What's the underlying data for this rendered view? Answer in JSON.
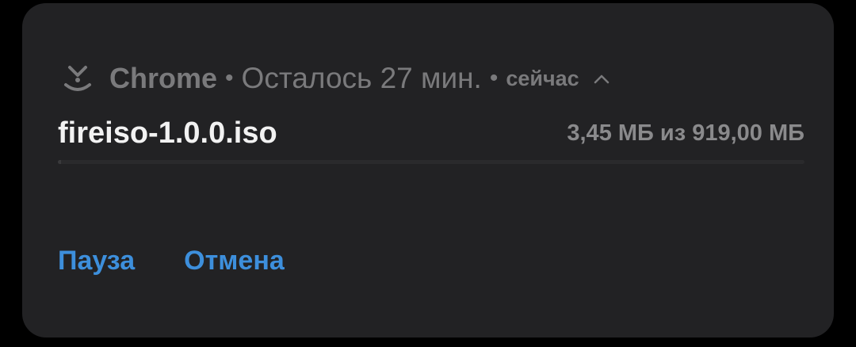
{
  "notification": {
    "app_name": "Chrome",
    "separator": "•",
    "remaining": "Осталось 27 мин.",
    "time": "сейчас",
    "icon": "download-icon",
    "expand_icon": "chevron-up-icon"
  },
  "download": {
    "file_name": "fireiso-1.0.0.iso",
    "size_text": "3,45 МБ из 919,00 МБ",
    "progress_fraction": 0.0038
  },
  "actions": {
    "pause_label": "Пауза",
    "cancel_label": "Отмена"
  },
  "colors": {
    "card_bg": "#222224",
    "accent": "#3d8fdc",
    "muted_text": "#7a7a7c",
    "primary_text": "#f2f2f2"
  }
}
